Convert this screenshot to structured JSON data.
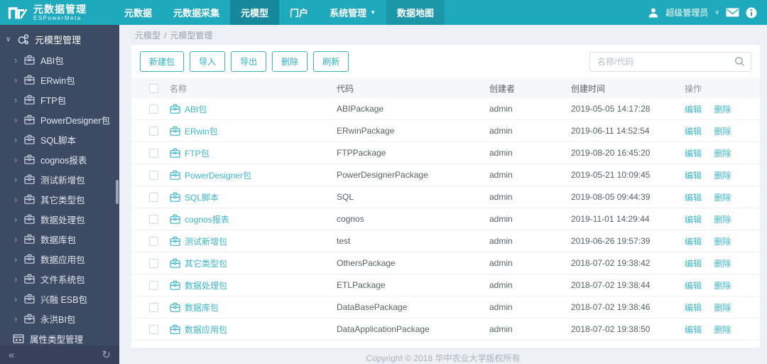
{
  "colors": {
    "navbar": "#1fa9bc",
    "navbar_active": "#15889b",
    "sidebar": "#3d4a63",
    "accent": "#38b4c6"
  },
  "icons": {
    "chevron_down": "∨",
    "chevron_right": "›",
    "caret_down": "▼",
    "user_chevron": "∨",
    "collapse": "«",
    "refresh": "↻"
  },
  "navbar": {
    "logo_title": "元数据管理",
    "logo_subtitle": "ESPowerMeta",
    "items": [
      {
        "label": "元数据",
        "active": false
      },
      {
        "label": "元数据采集",
        "active": false
      },
      {
        "label": "元模型",
        "active": true
      },
      {
        "label": "门户",
        "active": false
      },
      {
        "label": "系统管理",
        "active": false,
        "caret": true
      },
      {
        "label": "数据地图",
        "active": false,
        "highlight": true
      }
    ],
    "user": "超级管理员"
  },
  "sidebar": {
    "root": "元模型管理",
    "items": [
      "ABI包",
      "ERwin包",
      "FTP包",
      "PowerDesigner包",
      "SQL脚本",
      "cognos报表",
      "测试新增包",
      "其它类型包",
      "数据处理包",
      "数据库包",
      "数据应用包",
      "文件系统包",
      "兴融 ESB包",
      "永洪BI包"
    ],
    "bottom_item": "属性类型管理"
  },
  "breadcrumb": {
    "parts": [
      "元模型",
      "元模型管理"
    ],
    "separator": "/"
  },
  "toolbar": {
    "buttons": [
      "新建包",
      "导入",
      "导出",
      "删除",
      "刷新"
    ],
    "search_placeholder": "名称/代码"
  },
  "table": {
    "columns": [
      "名称",
      "代码",
      "创建者",
      "创建时间",
      "操作"
    ],
    "actions": {
      "edit": "编辑",
      "delete": "删除"
    },
    "rows": [
      {
        "name": "ABI包",
        "code": "ABIPackage",
        "creator": "admin",
        "created": "2019-05-05 14:17:28"
      },
      {
        "name": "ERwin包",
        "code": "ERwinPackage",
        "creator": "admin",
        "created": "2019-06-11 14:52:54"
      },
      {
        "name": "FTP包",
        "code": "FTPPackage",
        "creator": "admin",
        "created": "2019-08-20 16:45:20"
      },
      {
        "name": "PowerDesigner包",
        "code": "PowerDesignerPackage",
        "creator": "admin",
        "created": "2019-05-21 10:09:45"
      },
      {
        "name": "SQL脚本",
        "code": "SQL",
        "creator": "admin",
        "created": "2019-08-05 09:44:39"
      },
      {
        "name": "cognos报表",
        "code": "cognos",
        "creator": "admin",
        "created": "2019-11-01 14:29:44"
      },
      {
        "name": "测试新增包",
        "code": "test",
        "creator": "admin",
        "created": "2019-06-26 19:57:39"
      },
      {
        "name": "其它类型包",
        "code": "OthersPackage",
        "creator": "admin",
        "created": "2018-07-02 19:38:42"
      },
      {
        "name": "数据处理包",
        "code": "ETLPackage",
        "creator": "admin",
        "created": "2018-07-02 19:38:44"
      },
      {
        "name": "数据库包",
        "code": "DataBasePackage",
        "creator": "admin",
        "created": "2018-07-02 19:38:46"
      },
      {
        "name": "数据应用包",
        "code": "DataApplicationPackage",
        "creator": "admin",
        "created": "2018-07-02 19:38:50"
      }
    ]
  },
  "footer": {
    "copyright": "Copyright © 2018 华中农业大学版权所有"
  }
}
